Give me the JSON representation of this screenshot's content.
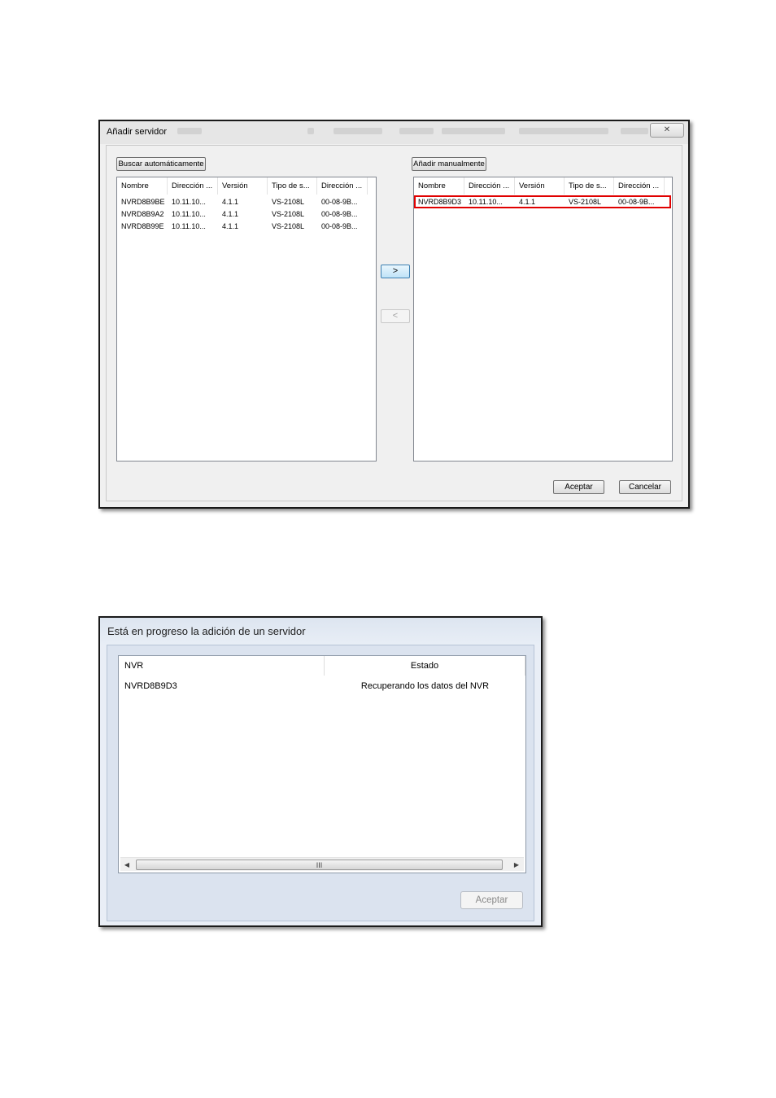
{
  "dialog_add": {
    "title": "Añadir servidor",
    "close_glyph": "✕",
    "auto_search_button": "Buscar automáticamente",
    "manual_add_button": "Añadir manualmente",
    "columns": [
      "Nombre",
      "Dirección ...",
      "Versión",
      "Tipo de s...",
      "Dirección ..."
    ],
    "left_rows": [
      [
        "NVRD8B9BE",
        "10.11.10...",
        "4.1.1",
        "VS-2108L",
        "00-08-9B..."
      ],
      [
        "NVRD8B9A2",
        "10.11.10...",
        "4.1.1",
        "VS-2108L",
        "00-08-9B..."
      ],
      [
        "NVRD8B99E",
        "10.11.10...",
        "4.1.1",
        "VS-2108L",
        "00-08-9B..."
      ]
    ],
    "right_rows": [
      [
        "NVRD8B9D3",
        "10.11.10...",
        "4.1.1",
        "VS-2108L",
        "00-08-9B..."
      ]
    ],
    "move_right_label": ">",
    "move_left_label": "<",
    "ok_button": "Aceptar",
    "cancel_button": "Cancelar",
    "highlight_color": "#e00000"
  },
  "dialog_progress": {
    "title": "Está en progreso la adición de un servidor",
    "columns": [
      "NVR",
      "Estado"
    ],
    "rows": [
      [
        "NVRD8B9D3",
        "Recuperando los datos del NVR"
      ]
    ],
    "scroll_left": "◀",
    "scroll_right": "▶",
    "scroll_grip": "III",
    "ok_button": "Aceptar"
  }
}
